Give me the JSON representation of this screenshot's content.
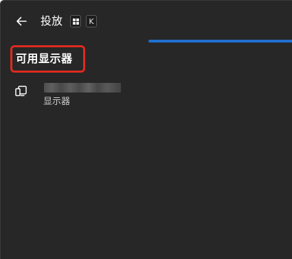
{
  "header": {
    "back_icon": "arrow-left-icon",
    "title": "投放",
    "shortcut": {
      "win_icon": "windows-logo-icon",
      "key": "K"
    }
  },
  "accent_color": "#1f6fd0",
  "highlight_color": "#e02a1f",
  "section": {
    "title": "可用显示器"
  },
  "devices": [
    {
      "icon": "cast-display-icon",
      "name": "",
      "type": "显示器"
    }
  ]
}
